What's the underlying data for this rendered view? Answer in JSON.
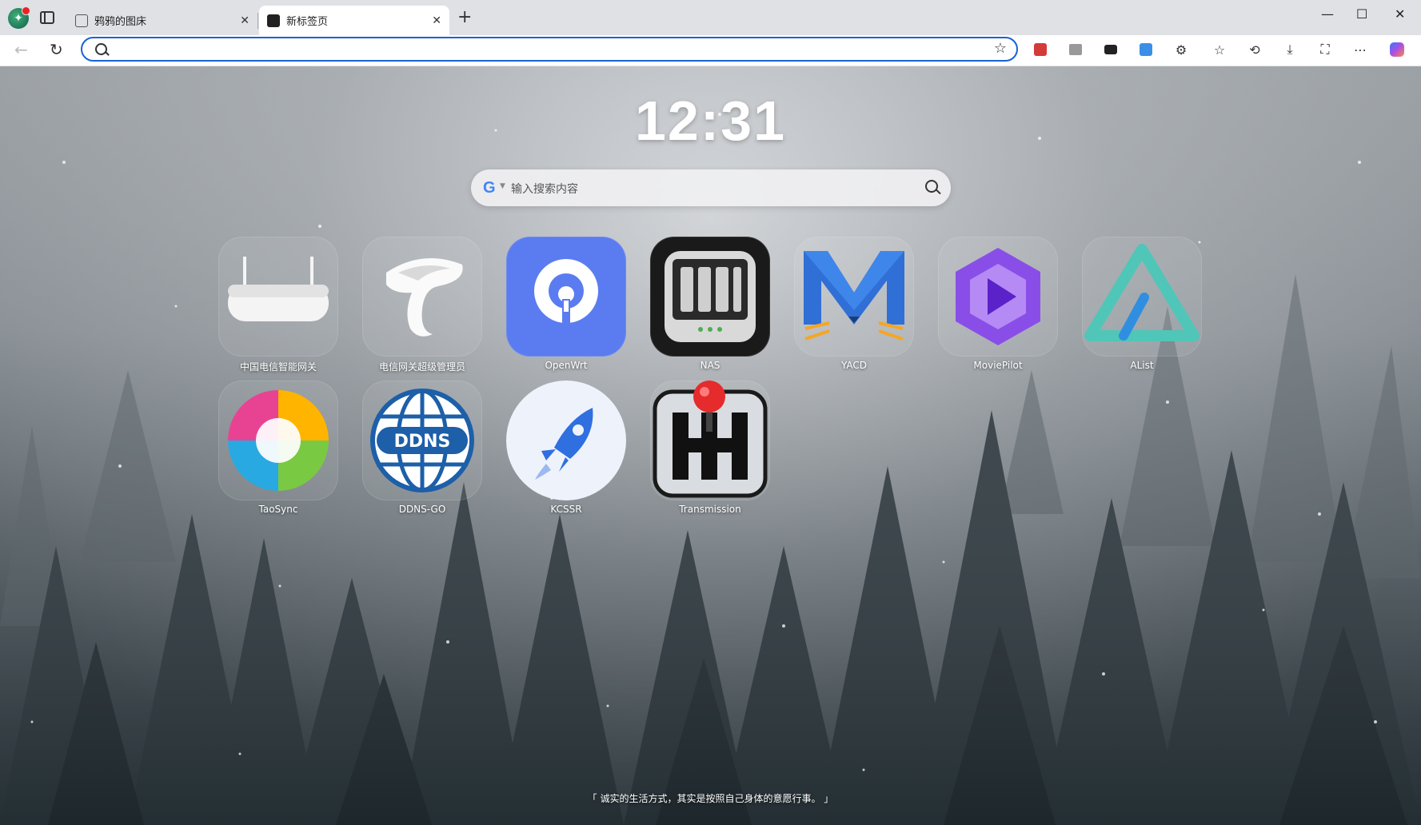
{
  "browser": {
    "tabs": [
      {
        "title": "鸦鸦的图床",
        "active": false
      },
      {
        "title": "新标签页",
        "active": true
      }
    ],
    "close_glyph": "✕",
    "new_tab_glyph": "+",
    "window_controls": {
      "minimize": "—",
      "maximize": "☐",
      "close": "✕"
    },
    "address": {
      "value": "",
      "placeholder": ""
    },
    "toolbar_icons": [
      "extension-red-icon",
      "image-extension-icon",
      "reader-icon",
      "translate-icon",
      "extensions-icon",
      "favorites-icon",
      "history-icon",
      "downloads-icon",
      "screenshot-icon",
      "more-icon",
      "copilot-icon"
    ],
    "accent_color": "#1a62d6"
  },
  "page": {
    "clock": "12:31",
    "search": {
      "engine_glyph": "G",
      "placeholder": "输入搜索内容"
    },
    "apps": [
      {
        "label": "中国电信智能网关",
        "icon": "router-icon"
      },
      {
        "label": "电信网关超级管理员",
        "icon": "china-telecom-icon"
      },
      {
        "label": "OpenWrt",
        "icon": "openwrt-icon"
      },
      {
        "label": "NAS",
        "icon": "nas-icon"
      },
      {
        "label": "YACD",
        "icon": "yacd-icon"
      },
      {
        "label": "MoviePilot",
        "icon": "moviepilot-icon"
      },
      {
        "label": "AList",
        "icon": "alist-icon"
      },
      {
        "label": "TaoSync",
        "icon": "taosync-icon"
      },
      {
        "label": "DDNS-GO",
        "icon": "ddns-go-icon"
      },
      {
        "label": "KCSSR",
        "icon": "kcssr-icon"
      },
      {
        "label": "Transmission",
        "icon": "transmission-icon"
      }
    ],
    "ddns_text": "DDNS",
    "quote": "「 诚实的生活方式，其实是按照自己身体的意愿行事。 」"
  }
}
